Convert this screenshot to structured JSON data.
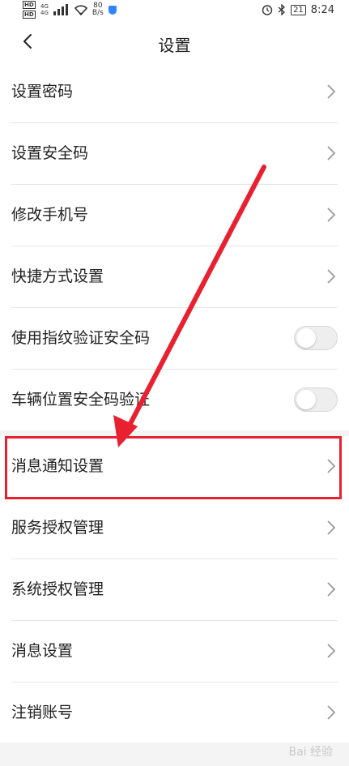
{
  "status_bar": {
    "hd1": "HD",
    "hd2": "HD",
    "net1": "4G",
    "net2": "4G",
    "speed_value": "80",
    "speed_unit": "B/s",
    "battery": "21",
    "time": "8:24",
    "icons": [
      "wifi-icon",
      "shield-icon",
      "alarm-icon",
      "bluetooth-icon",
      "battery-icon"
    ]
  },
  "header": {
    "title": "设置",
    "back_icon": "chevron-left-icon"
  },
  "group1": [
    {
      "label": "设置密码",
      "control": "chevron"
    },
    {
      "label": "设置安全码",
      "control": "chevron"
    },
    {
      "label": "修改手机号",
      "control": "chevron"
    },
    {
      "label": "快捷方式设置",
      "control": "chevron"
    },
    {
      "label": "使用指纹验证安全码",
      "control": "toggle",
      "on": false
    },
    {
      "label": "车辆位置安全码验证",
      "control": "toggle",
      "on": false
    }
  ],
  "group2": [
    {
      "label": "消息通知设置",
      "control": "chevron"
    },
    {
      "label": "服务授权管理",
      "control": "chevron"
    },
    {
      "label": "系统授权管理",
      "control": "chevron"
    },
    {
      "label": "消息设置",
      "control": "chevron"
    },
    {
      "label": "注销账号",
      "control": "chevron"
    }
  ],
  "annotation": {
    "highlight_color": "#e8202f"
  },
  "watermark": "Bai 经验"
}
